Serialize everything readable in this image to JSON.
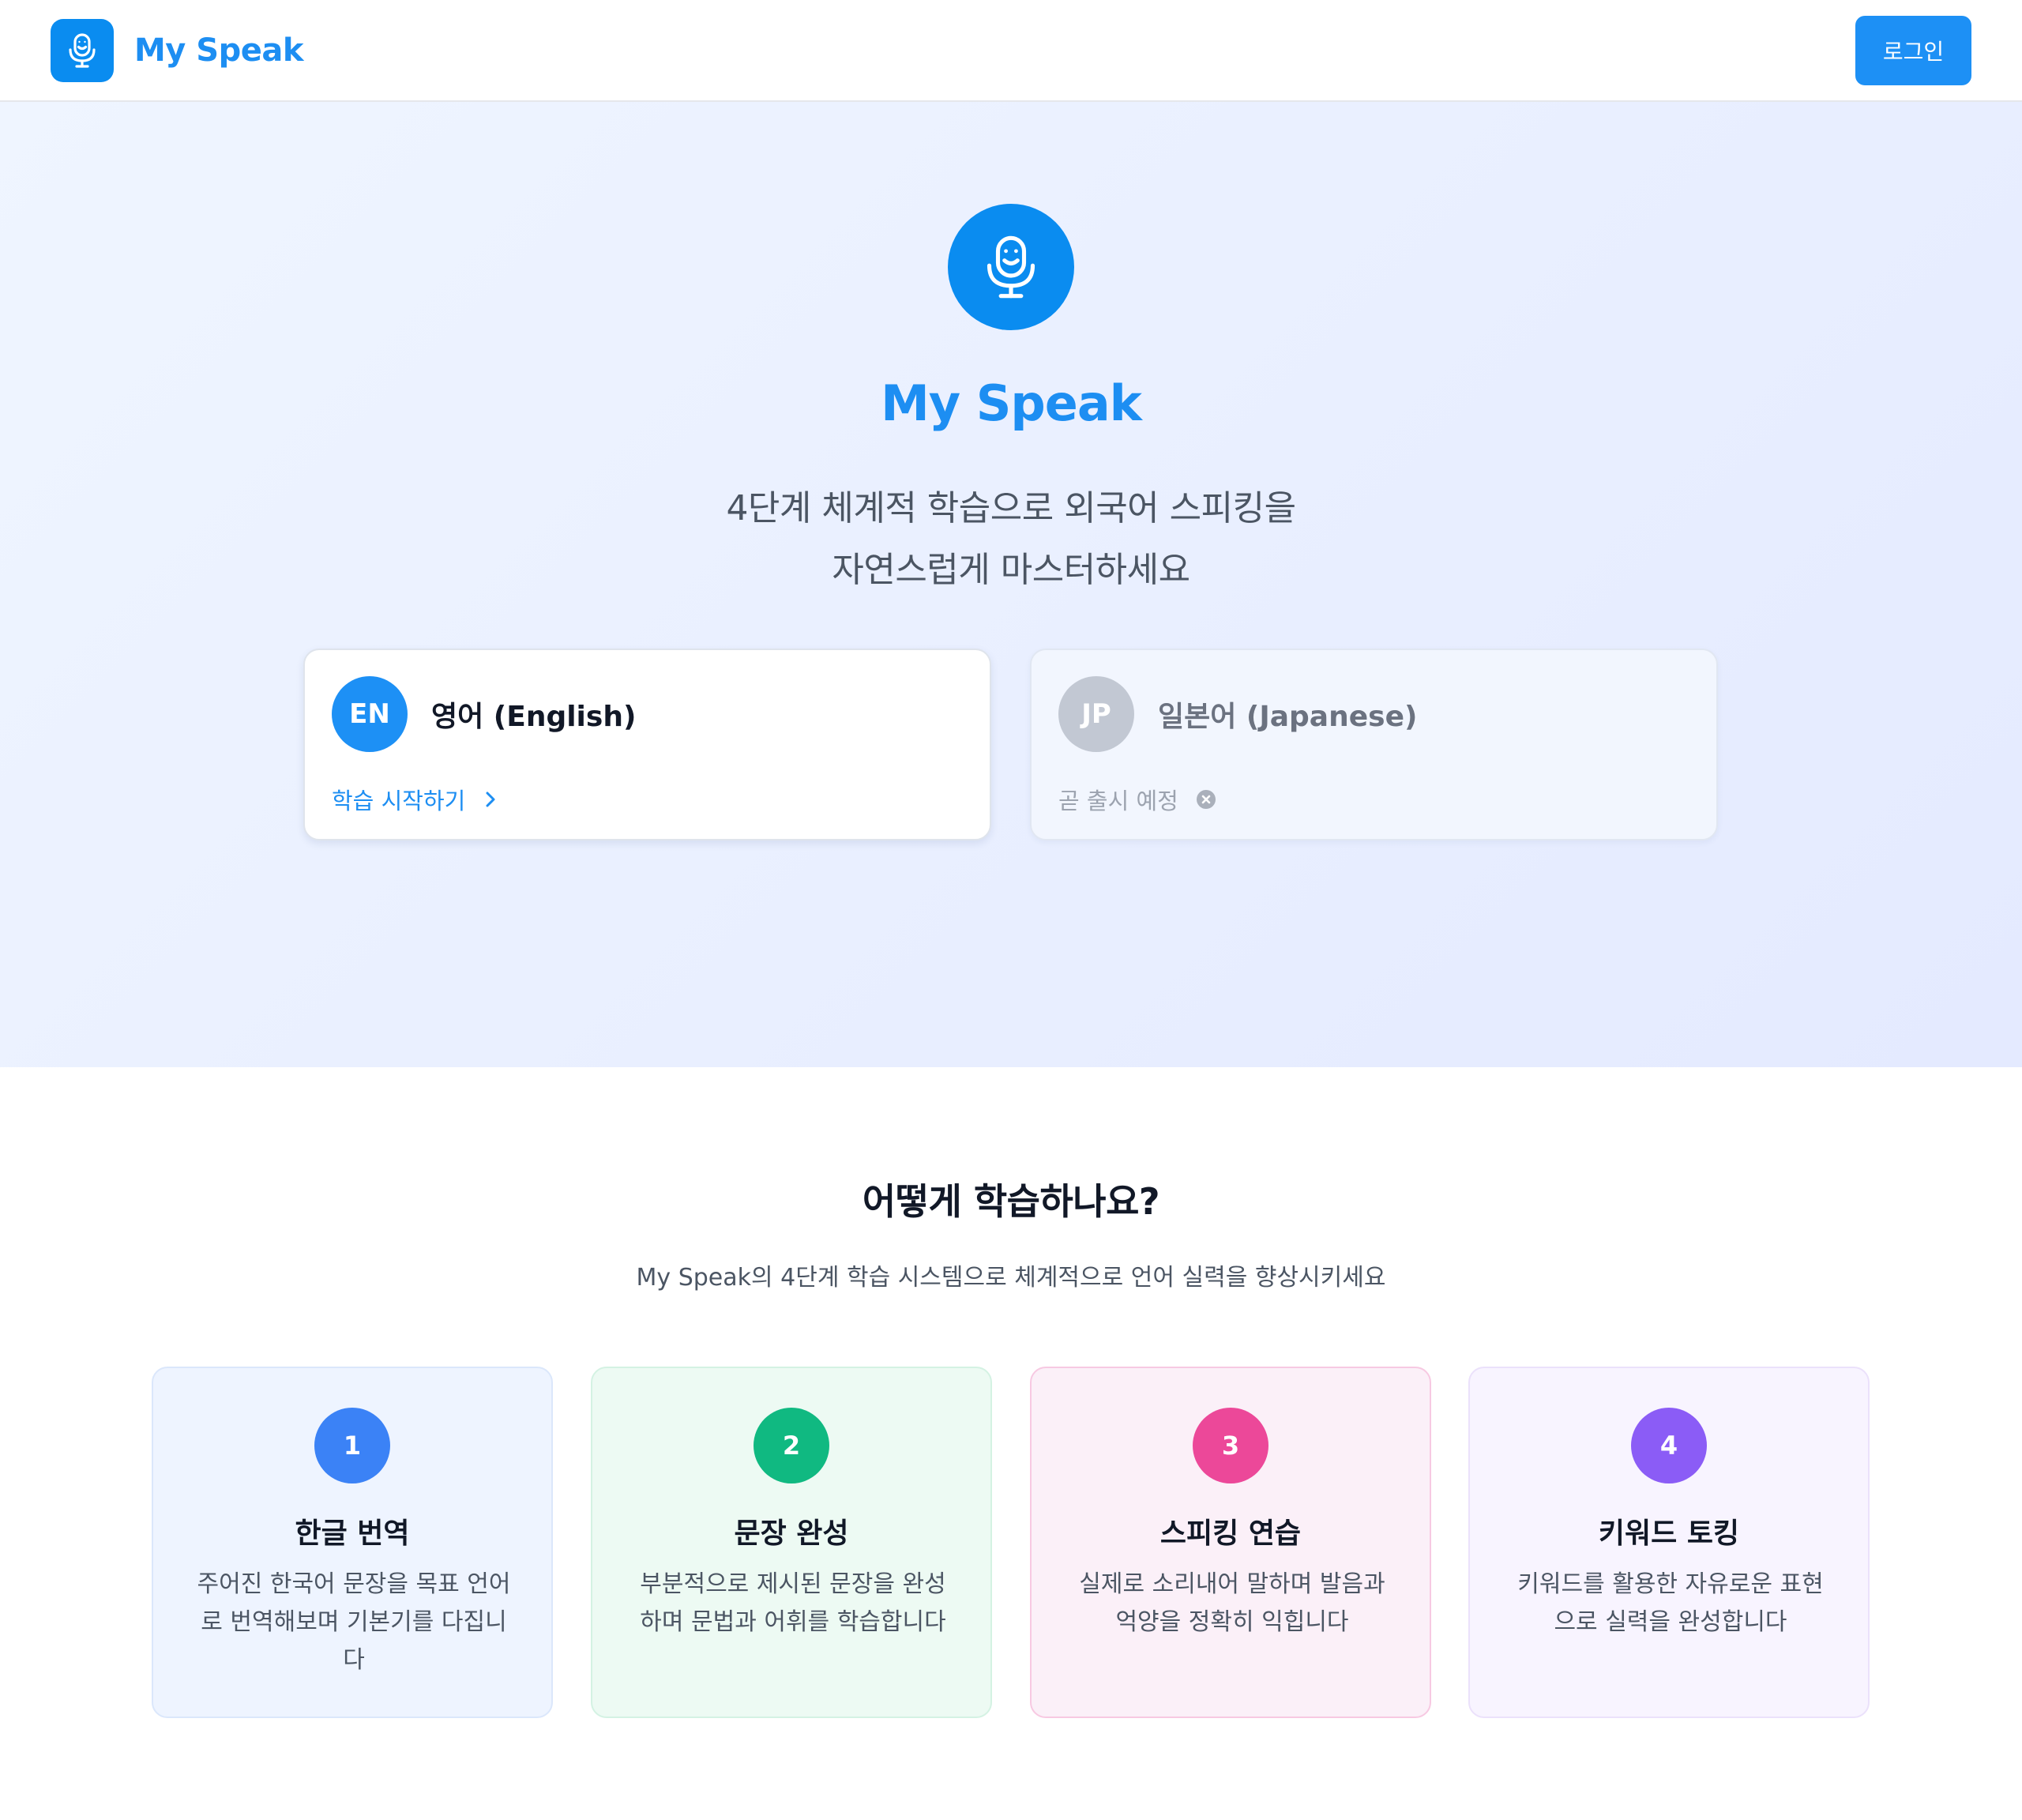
{
  "header": {
    "brand_name": "My Speak",
    "login_label": "로그인"
  },
  "hero": {
    "title": "My Speak",
    "subtitle_line1": "4단계 체계적 학습으로 외국어 스피킹을",
    "subtitle_line2": "자연스럽게 마스터하세요",
    "icon": "microphone-smile-icon",
    "languages": [
      {
        "code": "EN",
        "name": "영어 (English)",
        "action": "학습 시작하기",
        "action_icon": "chevron-right-icon",
        "available": true
      },
      {
        "code": "JP",
        "name": "일본어 (Japanese)",
        "action": "곧 출시 예정",
        "action_icon": "close-circle-icon",
        "available": false
      }
    ]
  },
  "how": {
    "title": "어떻게 학습하나요?",
    "subtitle": "My Speak의 4단계 학습 시스템으로 체계적으로 언어 실력을 향상시키세요",
    "steps": [
      {
        "number": "1",
        "title": "한글 번역",
        "desc_lines": [
          "주어진 한국어 문장을 목표 언어",
          "로 번역해보며 기본기를 다집니",
          "다"
        ],
        "color": "#3b82f6"
      },
      {
        "number": "2",
        "title": "문장 완성",
        "desc_lines": [
          "부분적으로 제시된 문장을 완성",
          "하며 문법과 어휘를 학습합니다"
        ],
        "color": "#10b981"
      },
      {
        "number": "3",
        "title": "스피킹 연습",
        "desc_lines": [
          "실제로 소리내어 말하며 발음과",
          "억양을 정확히 익힙니다"
        ],
        "color": "#ec4899"
      },
      {
        "number": "4",
        "title": "키워드 토킹",
        "desc_lines": [
          "키워드를 활용한 자유로운 표현",
          "으로 실력을 완성합니다"
        ],
        "color": "#8b5cf6"
      }
    ]
  },
  "colors": {
    "brand": "#1d8ef2",
    "brand_icon_bg": "#0a8cf0",
    "hero_bg": "#eaf0ff"
  }
}
